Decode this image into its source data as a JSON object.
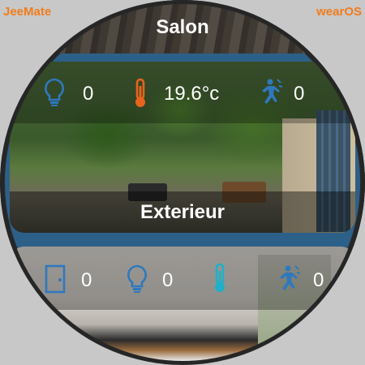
{
  "brand": {
    "left": "JeeMate",
    "right": "wearOS"
  },
  "rooms": [
    {
      "name": "Salon"
    },
    {
      "name": "Exterieur",
      "sensors": [
        {
          "icon": "lightbulb-icon",
          "value": "0"
        },
        {
          "icon": "thermometer-icon",
          "value": "19.6°c"
        },
        {
          "icon": "motion-icon",
          "value": "0"
        }
      ]
    },
    {
      "sensors": [
        {
          "icon": "door-icon",
          "value": "0"
        },
        {
          "icon": "lightbulb-icon",
          "value": "0"
        },
        {
          "icon": "thermometer-icon",
          "value": ""
        },
        {
          "icon": "motion-icon",
          "value": "0"
        }
      ]
    }
  ],
  "colors": {
    "accent": "#f07c1e",
    "icon_blue": "#2e79bd",
    "thermo_orange": "#e8641d",
    "thermo_cyan": "#1fb0c8",
    "background": "#2d6088"
  }
}
